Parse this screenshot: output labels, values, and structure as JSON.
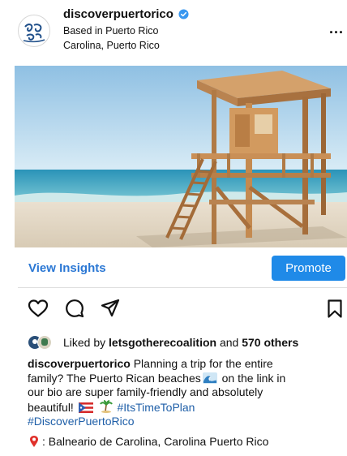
{
  "post": {
    "username": "discoverpuertorico",
    "subtitle_1": "Based in Puerto Rico",
    "subtitle_2": "Carolina, Puerto Rico",
    "more_label": "..."
  },
  "insights": {
    "view_label": "View Insights",
    "promote_label": "Promote"
  },
  "likes": {
    "prefix": "Liked by",
    "user": "letsgotherecoalition",
    "connector": "and",
    "others": "570 others"
  },
  "caption": {
    "author": "discoverpuertorico",
    "line1_text": " Planning a trip for the entire",
    "line2_a": "family? The Puerto Rican beaches",
    "line2_b": " on the link in",
    "line3": "our bio are super family-friendly and absolutely",
    "line4_a": "beautiful!",
    "hashtag1": "#ItsTimeToPlan",
    "hashtag2": "#DiscoverPuertoRico",
    "location_text": ": Balneario de Carolina, Carolina Puerto Rico"
  },
  "icons": {
    "verified": "verified-badge-icon",
    "like": "heart-icon",
    "comment": "comment-icon",
    "share": "share-icon",
    "save": "bookmark-icon",
    "location": "pin-icon"
  },
  "colors": {
    "accent_link": "#2a77d4",
    "promote_bg": "#1f8ae8",
    "hashtag": "#1f5fa8"
  }
}
